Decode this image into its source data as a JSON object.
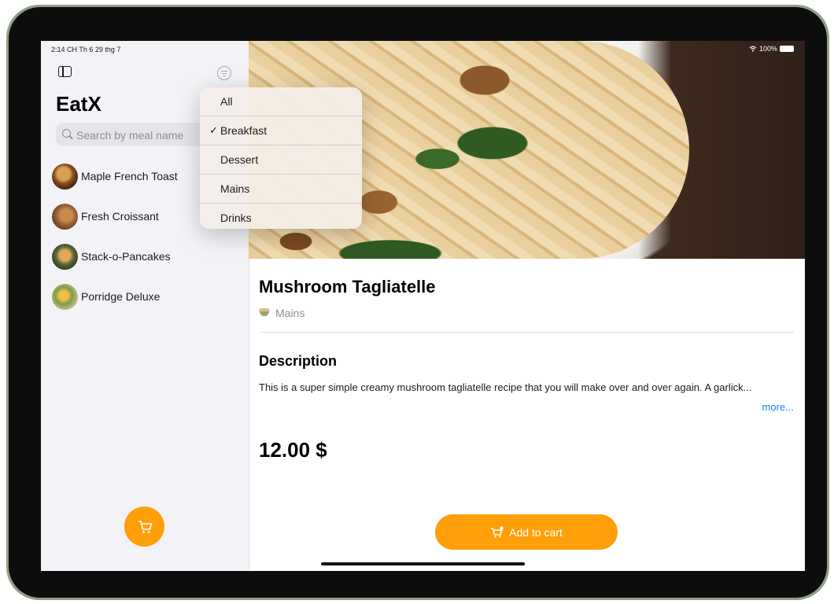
{
  "status_bar": {
    "time": "2:14 CH  Th 6 29 thg 7",
    "battery": "100%",
    "more_dots": "•••"
  },
  "sidebar": {
    "title": "EatX",
    "search_placeholder": "Search by meal name",
    "meals": [
      {
        "label": "Maple French Toast"
      },
      {
        "label": "Fresh Croissant"
      },
      {
        "label": "Stack-o-Pancakes"
      },
      {
        "label": "Porridge Deluxe"
      }
    ]
  },
  "filter_menu": {
    "items": [
      {
        "label": "All",
        "check": ""
      },
      {
        "label": "Breakfast",
        "check": "✓"
      },
      {
        "label": "Dessert",
        "check": ""
      },
      {
        "label": "Mains",
        "check": ""
      },
      {
        "label": "Drinks",
        "check": ""
      }
    ],
    "selected": "Breakfast"
  },
  "detail": {
    "title": "Mushroom Tagliatelle",
    "category": "Mains",
    "description_heading": "Description",
    "description": "This is a super simple creamy mushroom tagliatelle recipe that you will make over and over again. A garlick...",
    "more_label": "more...",
    "price": "12.00 $",
    "add_to_cart_label": "Add to cart"
  },
  "colors": {
    "accent": "#ff9f0a",
    "link": "#0a84ff",
    "sidebar_bg": "#f2f2f7"
  }
}
